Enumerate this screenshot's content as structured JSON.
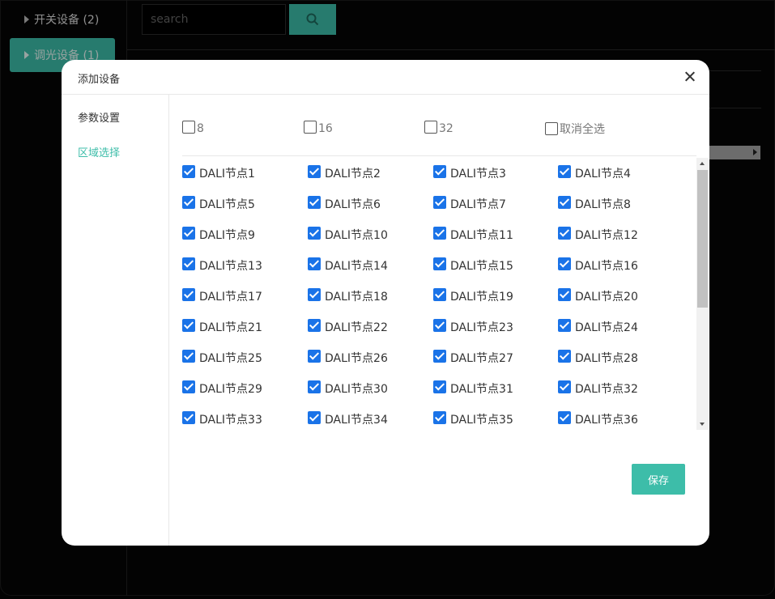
{
  "background": {
    "nav": [
      {
        "label": "开关设备 (2)",
        "active": false
      },
      {
        "label": "调光设备 (1)",
        "active": true
      }
    ],
    "search_placeholder": "search"
  },
  "modal": {
    "title": "添加设备",
    "side_menu": [
      {
        "label": "参数设置",
        "active": false
      },
      {
        "label": "区域选择",
        "active": true
      }
    ],
    "top_options": [
      {
        "label": "8",
        "checked": false
      },
      {
        "label": "16",
        "checked": false
      },
      {
        "label": "32",
        "checked": false
      },
      {
        "label": "取消全选",
        "checked": false
      }
    ],
    "nodes": [
      "DALI节点1",
      "DALI节点2",
      "DALI节点3",
      "DALI节点4",
      "DALI节点5",
      "DALI节点6",
      "DALI节点7",
      "DALI节点8",
      "DALI节点9",
      "DALI节点10",
      "DALI节点11",
      "DALI节点12",
      "DALI节点13",
      "DALI节点14",
      "DALI节点15",
      "DALI节点16",
      "DALI节点17",
      "DALI节点18",
      "DALI节点19",
      "DALI节点20",
      "DALI节点21",
      "DALI节点22",
      "DALI节点23",
      "DALI节点24",
      "DALI节点25",
      "DALI节点26",
      "DALI节点27",
      "DALI节点28",
      "DALI节点29",
      "DALI节点30",
      "DALI节点31",
      "DALI节点32",
      "DALI节点33",
      "DALI节点34",
      "DALI节点35",
      "DALI节点36"
    ],
    "nodes_checked": true,
    "save_label": "保存"
  },
  "colors": {
    "accent": "#3dbda9",
    "checkbox": "#1a73e8"
  }
}
